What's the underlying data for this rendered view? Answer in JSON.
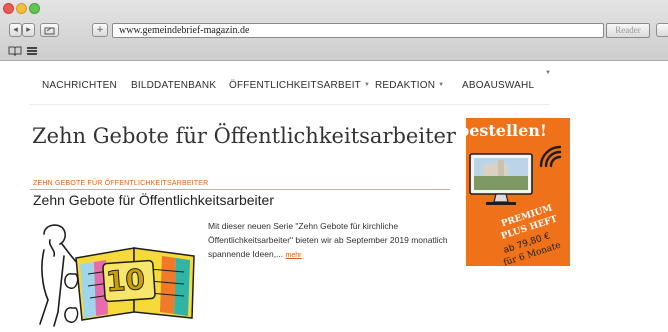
{
  "browser": {
    "url": "www.gemeindebrief-magazin.de",
    "reader_label": "Reader"
  },
  "colors": {
    "accent": "#e0601c",
    "ad_background": "#ef7119",
    "ad_text": "#ffffff",
    "nav_text": "#2f2f2f"
  },
  "nav": {
    "items": [
      {
        "label": "NACHRICHTEN"
      },
      {
        "label": "BILDDATENBANK"
      },
      {
        "label": "ÖFFENTLICHKEITSARBEIT"
      },
      {
        "label": "REDAKTION"
      },
      {
        "label": "ABOAUSWAHL"
      }
    ]
  },
  "main": {
    "page_title": "Zehn Gebote für Öffentlichkeitsarbeiter",
    "category": "ZEHN GEBOTE FÜR ÖFFENTLICHKEITSARBEITER",
    "article": {
      "title": "Zehn Gebote für Öffentlichkeitsarbeiter",
      "excerpt": "Mit dieser neuen Serie \"Zehn Gebote für kirchliche Öffentlichkeitsarbeiter\" bieten wir ab September 2019 monatlich spannende Ideen,...",
      "more_link": "mehr",
      "image_number": "10"
    }
  },
  "ad": {
    "headline": "bestellen!",
    "badge_line1": "PREMIUM",
    "badge_line2": "PLUS HEFT",
    "price": "ab 79,80 €",
    "duration": "für 6 Monate"
  }
}
